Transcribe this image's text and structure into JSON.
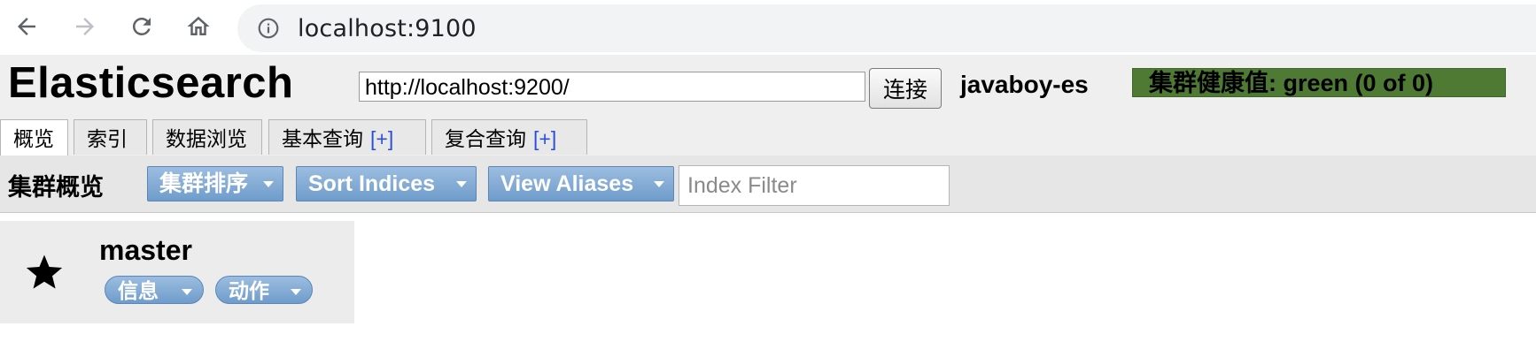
{
  "browser": {
    "url": "localhost:9100",
    "icons": [
      "back-arrow-icon",
      "forward-arrow-icon",
      "reload-icon",
      "home-icon",
      "info-icon"
    ]
  },
  "app": {
    "title": "Elasticsearch",
    "connect_url": "http://localhost:9200/",
    "connect_label": "连接",
    "cluster_name": "javaboy-es",
    "health_text": "集群健康值: green (0 of 0)",
    "health_color": "#4e7a33"
  },
  "tabs": [
    {
      "label": "概览",
      "plus": ""
    },
    {
      "label": "索引",
      "plus": ""
    },
    {
      "label": "数据浏览",
      "plus": ""
    },
    {
      "label": "基本查询",
      "plus": "[+]"
    },
    {
      "label": "复合查询",
      "plus": "[+]"
    }
  ],
  "toolbar": {
    "title": "集群概览",
    "sort_cluster": "集群排序",
    "sort_indices": "Sort Indices",
    "view_aliases": "View Aliases",
    "filter_placeholder": "Index Filter"
  },
  "node": {
    "name": "master",
    "icon": "star-icon",
    "info_label": "信息",
    "action_label": "动作"
  },
  "colors": {
    "button_blue": "#6f9ccb",
    "link_blue": "#2a4fd6"
  }
}
